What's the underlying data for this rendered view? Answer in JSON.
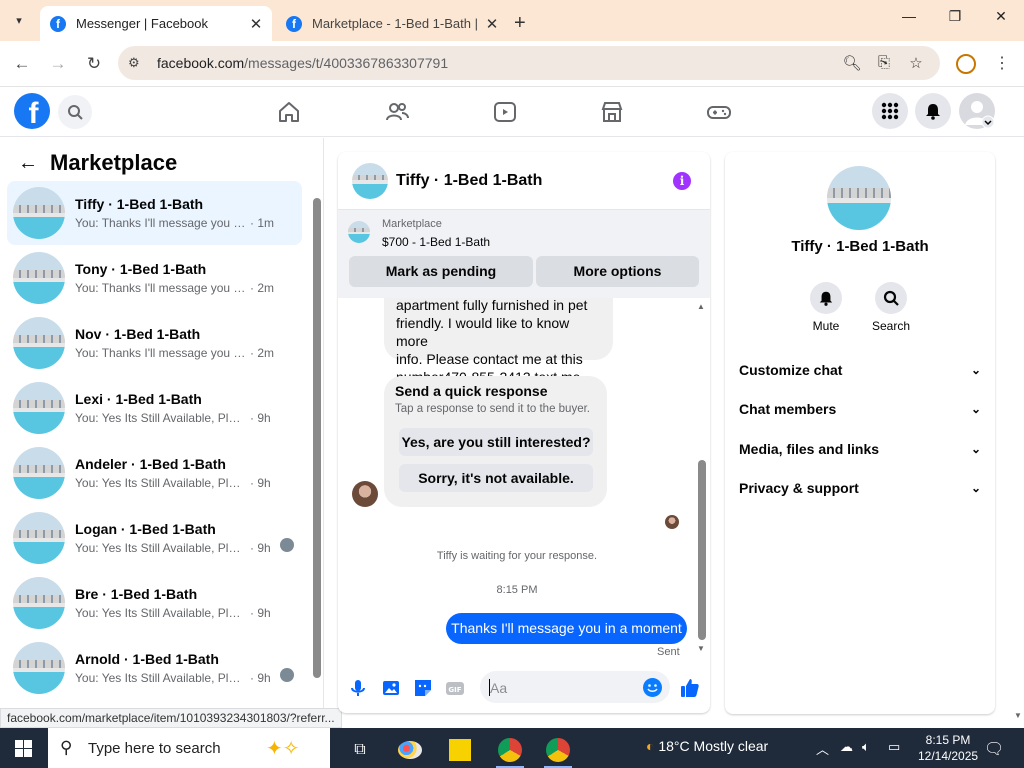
{
  "browser": {
    "tabs": [
      {
        "title": "Messenger | Facebook",
        "active": true
      },
      {
        "title": "Marketplace - 1-Bed 1-Bath | Fa",
        "active": false
      }
    ],
    "url_host": "facebook.com",
    "url_path": "/messages/t/4003367863307791"
  },
  "left": {
    "title": "Marketplace",
    "conversations": [
      {
        "name": "Tiffy · 1-Bed 1-Bath",
        "snippet": "You: Thanks I'll message you in a ...",
        "ago": "· 1m"
      },
      {
        "name": "Tony · 1-Bed 1-Bath",
        "snippet": "You: Thanks I'll message you in a ...",
        "ago": "· 2m"
      },
      {
        "name": "Nov · 1-Bed 1-Bath",
        "snippet": "You: Thanks I'll message you in a ...",
        "ago": "· 2m"
      },
      {
        "name": "Lexi · 1-Bed 1-Bath",
        "snippet": "You: Yes Its Still Available, Please Se...",
        "ago": "· 9h"
      },
      {
        "name": "Andeler · 1-Bed 1-Bath",
        "snippet": "You: Yes Its Still Available, Please Se...",
        "ago": "· 9h"
      },
      {
        "name": "Logan · 1-Bed 1-Bath",
        "snippet": "You: Yes Its Still Available, Please...",
        "ago": "· 9h"
      },
      {
        "name": "Bre · 1-Bed 1-Bath",
        "snippet": "You: Yes Its Still Available, Please Se...",
        "ago": "· 9h"
      },
      {
        "name": "Arnold · 1-Bed 1-Bath",
        "snippet": "You: Yes Its Still Available, Please Se...",
        "ago": "· 9h"
      }
    ]
  },
  "status_url": "facebook.com/marketplace/item/1010393234301803/?referr...",
  "chat": {
    "title": "Tiffy · 1-Bed 1-Bath",
    "listing_source": "Marketplace",
    "listing_price": "$700 - 1-Bed 1-Bath",
    "mark_pending": "Mark as pending",
    "more_options": "More options",
    "incoming_lines": [
      "apartment fully furnished in pet",
      "friendly. I would like to know more",
      "info. Please contact me at this",
      "number470-855-2413 text me"
    ],
    "quick_title": "Send a quick response",
    "quick_sub": "Tap a response to send it to the buyer.",
    "quick_opt1": "Yes, are you still interested?",
    "quick_opt2": "Sorry, it's not available.",
    "waiting": "Tiffy is waiting for your response.",
    "time": "8:15 PM",
    "outgoing": "Thanks I'll message you in a moment",
    "sent": "Sent",
    "placeholder": "Aa"
  },
  "info": {
    "name": "Tiffy · 1-Bed 1-Bath",
    "mute": "Mute",
    "search": "Search",
    "sections": [
      "Customize chat",
      "Chat members",
      "Media, files and links",
      "Privacy & support"
    ]
  },
  "taskbar": {
    "search_placeholder": "Type here to search",
    "weather": "18°C  Mostly clear",
    "time": "8:15 PM",
    "date": "12/14/2025"
  },
  "colors": {
    "facebook_blue": "#1877f2",
    "messenger_blue": "#0866ff",
    "info_purple": "#a033ff",
    "tab_bar": "#fce7d4"
  }
}
